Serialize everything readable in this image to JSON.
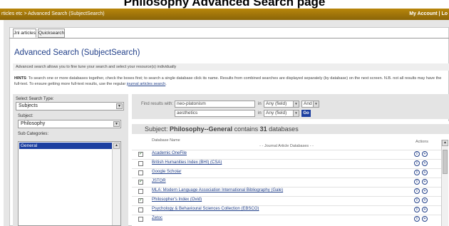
{
  "page_title": "Philosophy Advanced Search page",
  "topbar": {
    "breadcrumb": "rticles etc > Advanced Search (SubjectSearch)",
    "account": "My Account | Lo"
  },
  "tabs": [
    {
      "label": "Jnl articles"
    },
    {
      "label": "Quicksearch"
    }
  ],
  "heading": "Advanced Search (SubjectSearch)",
  "note": "Advanced search allows you to fine tune your search and select your resource(s) individually",
  "hints": {
    "label": "HINTS",
    "text": ": To search one or more databases together, check the boxes first; to search a single database click its name. Results from combined searches are displayed separately (by database) on the next screen. N.B. not all results may have the full-text. To ensure getting more full-text results, use the regular ",
    "link": "journal articles search",
    "end": "."
  },
  "left": {
    "search_type_label": "Select Search Type:",
    "search_type_value": "Subjects",
    "subject_label": "Subject:",
    "subject_value": "Philosophy",
    "subcat_label": "Sub Categories:",
    "subcat_selected": "General"
  },
  "search": {
    "find_label": "Find results with:",
    "term1": "neo-platonism",
    "term2": "aesthetics",
    "in_word": "in",
    "field1": "Any (field)",
    "field2": "Any (field)",
    "bool": "And",
    "go_label": "Go"
  },
  "results": {
    "subject_word": "Subject:",
    "subject_name": "Philosophy--General",
    "contains_text": "contains",
    "count": "31",
    "databases_word": "databases",
    "col_name": "Database Name",
    "col_actions": "Actions",
    "group_label": "- - Journal Article Databases - -",
    "rows": [
      {
        "name": "Academic OneFile",
        "checked": true
      },
      {
        "name": "British Humanities Index (BHI) (CSA)",
        "checked": false
      },
      {
        "name": "Google Scholar",
        "checked": false
      },
      {
        "name": "JSTOR",
        "checked": true
      },
      {
        "name": "MLA: Modern Language Association International Bibliography (Gale)",
        "checked": false
      },
      {
        "name": "Philosopher's Index (Ovid)",
        "checked": true
      },
      {
        "name": "Psychology & Behavioural Sciences Collection (EBSCO)",
        "checked": false
      },
      {
        "name": "Zetoc",
        "checked": false
      }
    ]
  },
  "icons": {
    "info": "info-icon",
    "add": "plus-icon"
  }
}
